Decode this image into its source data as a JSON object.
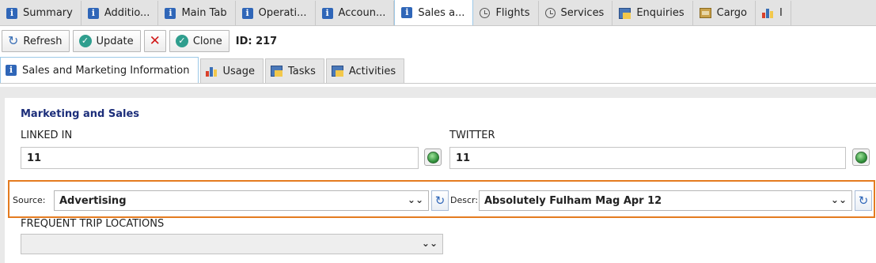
{
  "top_tabs": [
    {
      "label": "Summary",
      "icon": "info-icon"
    },
    {
      "label": "Additio...",
      "icon": "info-icon"
    },
    {
      "label": "Main Tab",
      "icon": "info-icon"
    },
    {
      "label": "Operati...",
      "icon": "info-icon"
    },
    {
      "label": "Accoun...",
      "icon": "info-icon"
    },
    {
      "label": "Sales a...",
      "icon": "info-icon",
      "active": true
    },
    {
      "label": "Flights",
      "icon": "clock-icon"
    },
    {
      "label": "Services",
      "icon": "clock-icon"
    },
    {
      "label": "Enquiries",
      "icon": "ledger-icon"
    },
    {
      "label": "Cargo",
      "icon": "folder-icon"
    },
    {
      "label": "I",
      "icon": "bar-chart-icon"
    }
  ],
  "toolbar": {
    "refresh_label": "Refresh",
    "update_label": "Update",
    "clone_label": "Clone",
    "id_text": "ID: 217"
  },
  "sub_tabs": [
    {
      "label": "Sales and Marketing Information",
      "icon": "info-icon",
      "active": true
    },
    {
      "label": "Usage",
      "icon": "bar-chart-icon"
    },
    {
      "label": "Tasks",
      "icon": "ledger-icon"
    },
    {
      "label": "Activities",
      "icon": "ledger-icon"
    }
  ],
  "form": {
    "section_title": "Marketing and Sales",
    "linkedin": {
      "label": "LINKED IN",
      "value": "11"
    },
    "twitter": {
      "label": "TWITTER",
      "value": "11"
    },
    "source": {
      "label": "Source:",
      "value": "Advertising"
    },
    "descr": {
      "label": "Descr:",
      "value": "Absolutely Fulham Mag Apr 12"
    },
    "frequent_trip": {
      "label": "FREQUENT TRIP LOCATIONS",
      "value": ""
    }
  },
  "colors": {
    "highlight_border": "#e47b1f",
    "section_title": "#1c2e7a",
    "info_icon": "#2f66b8",
    "delete_icon": "#d11a1a"
  }
}
